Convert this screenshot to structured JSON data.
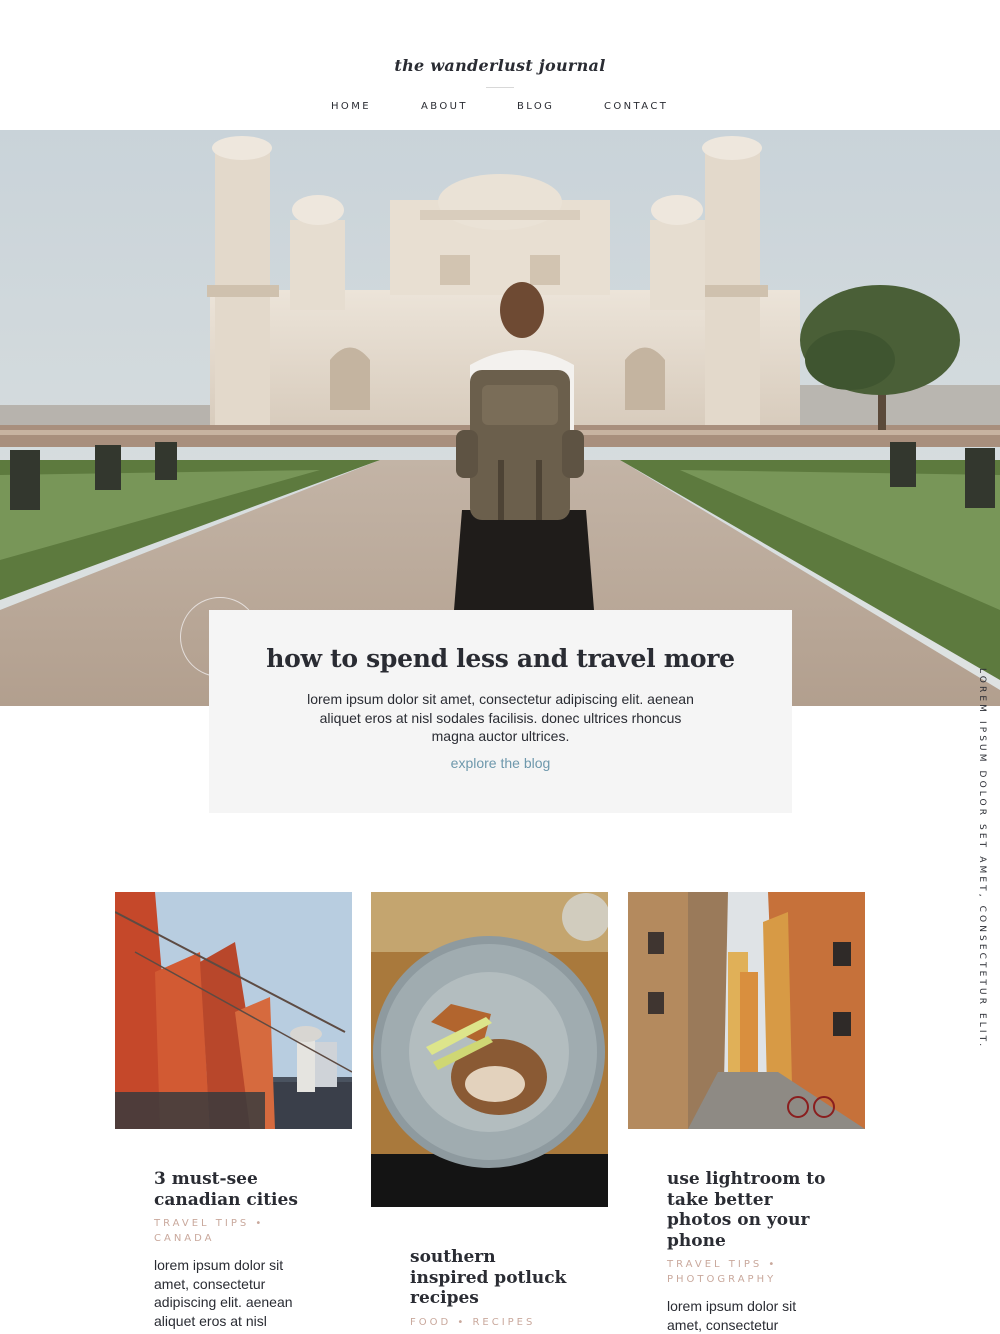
{
  "site": {
    "brand": "the wanderlust journal"
  },
  "nav": {
    "items": [
      "HOME",
      "ABOUT",
      "BLOG",
      "CONTACT"
    ]
  },
  "hero": {
    "image_description": "woman with backpack facing white marble mausoleum"
  },
  "feature": {
    "title": "how to spend less and travel more",
    "excerpt": "lorem ipsum dolor sit amet, consectetur adipiscing elit. aenean aliquet eros at nisl sodales facilisis. donec ultrices rhoncus magna auctor ultrices.",
    "link": "explore the blog"
  },
  "side_text": "LOREM IPSUM DOLOR SET AMET, CONSECTETUR ELIT.",
  "posts": [
    {
      "title_lines": [
        "3 must-see",
        "canadian cities"
      ],
      "category_lines": [
        "TRAVEL TIPS •",
        "CANADA"
      ],
      "excerpt_lines": [
        "lorem ipsum dolor sit",
        "amet, consectetur",
        "adipiscing elit. aenean",
        "aliquet eros at nisl"
      ]
    },
    {
      "title_lines": [
        "southern",
        "inspired potluck",
        "recipes"
      ],
      "category_lines": [
        "FOOD • RECIPES"
      ],
      "excerpt_lines": []
    },
    {
      "title_lines": [
        "use lightroom to",
        "take better",
        "photos on your",
        "phone"
      ],
      "category_lines": [
        "TRAVEL TIPS •",
        "PHOTOGRAPHY"
      ],
      "excerpt_lines": [
        "lorem ipsum dolor sit",
        "amet, consectetur"
      ]
    }
  ],
  "colors": {
    "text": "#2a2c33",
    "card_bg": "#f5f5f5",
    "link": "#6e98ac",
    "category": "#c9a89c"
  }
}
